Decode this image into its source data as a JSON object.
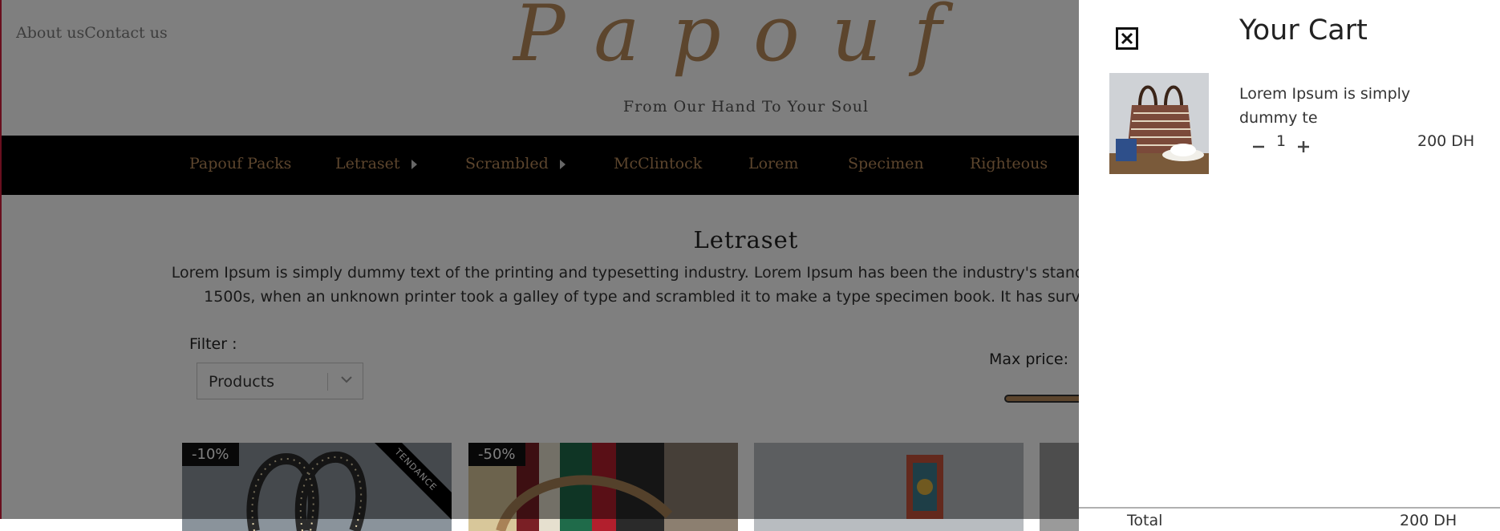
{
  "header": {
    "links": [
      "About us",
      "Contact us"
    ],
    "logo": "Papouf",
    "tagline": "From Our Hand To Your Soul"
  },
  "nav": {
    "items": [
      {
        "label": "Papouf Packs",
        "has_submenu": false
      },
      {
        "label": "Letraset",
        "has_submenu": true
      },
      {
        "label": "Scrambled",
        "has_submenu": true
      },
      {
        "label": "McClintock",
        "has_submenu": false
      },
      {
        "label": "Lorem",
        "has_submenu": false
      },
      {
        "label": "Specimen",
        "has_submenu": false
      },
      {
        "label": "Righteous",
        "has_submenu": false
      }
    ]
  },
  "section": {
    "title": "Letraset",
    "description": "Lorem Ipsum is simply dummy text of the printing and typesetting industry. Lorem Ipsum has been the industry's standard dummy text ever since the 1500s, when an unknown printer took a galley of type and scrambled it to make a type specimen book. It has survived not only five centuries"
  },
  "filters": {
    "label": "Filter :",
    "select_value": "Products",
    "max_price_label": "Max price:"
  },
  "products": [
    {
      "discount": "-10%",
      "badge": "TENDANCE"
    },
    {
      "discount": "-50%",
      "badge": ""
    },
    {
      "discount": "",
      "badge": ""
    }
  ],
  "cart": {
    "title": "Your Cart",
    "items": [
      {
        "name": "Lorem Ipsum is simply dummy te",
        "quantity": "1",
        "price": "200 DH"
      }
    ],
    "total_label": "Total",
    "total_value": "200 DH"
  },
  "colors": {
    "accent_gold": "#b98a5a",
    "navbar_bg": "#000000",
    "overlay": "rgba(0,0,0,0.5)",
    "edge_red": "#d21f3c"
  },
  "icons": {
    "close": "close-icon",
    "minus": "minus-icon",
    "plus": "plus-icon",
    "caret": "caret-right-icon",
    "chevron": "chevron-down-icon"
  }
}
